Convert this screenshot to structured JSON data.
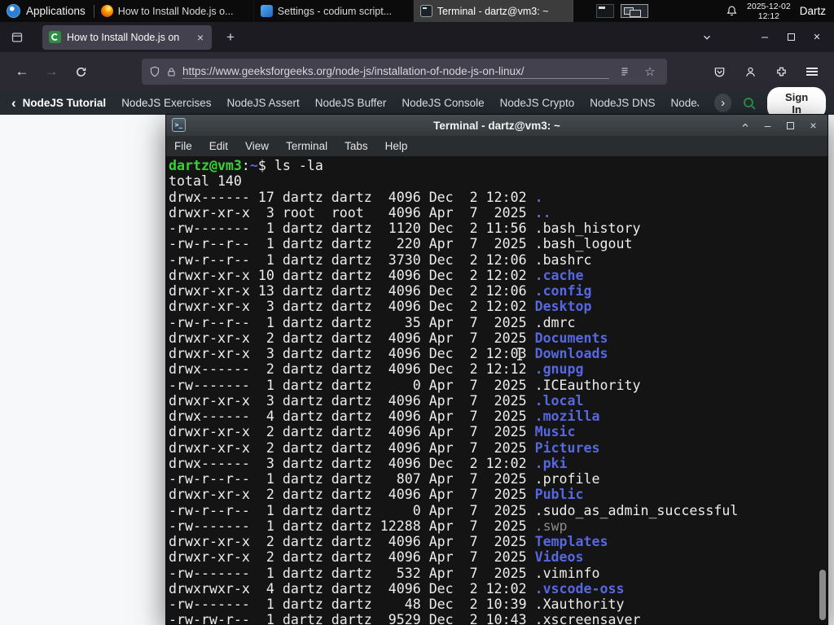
{
  "panel": {
    "applications": "Applications",
    "windows": [
      "How to Install Node.js o...",
      "Settings - codium script...",
      "Terminal - dartz@vm3: ~"
    ],
    "date": "2025-12-02",
    "time": "12:12",
    "user": "Dartz"
  },
  "browser": {
    "tab_title": "How to Install Node.js on",
    "url": "https://www.geeksforgeeks.org/node-js/installation-of-node-js-on-linux/"
  },
  "gfg": {
    "nav": [
      "NodeJS Tutorial",
      "NodeJS Exercises",
      "NodeJS Assert",
      "NodeJS Buffer",
      "NodeJS Console",
      "NodeJS Crypto",
      "NodeJS DNS",
      "NodeJS"
    ],
    "sign_in": "Sign In",
    "accent_green": "#2f8d46"
  },
  "glyphs": {
    "close": "×",
    "minimize": "–",
    "plus": "+",
    "back": "←",
    "forward": "→",
    "star": "☆",
    "chevron_left": "‹",
    "chevron_right": "›",
    "terminal_prompt": ">_"
  },
  "terminal": {
    "title": "Terminal - dartz@vm3: ~",
    "menu": [
      "File",
      "Edit",
      "View",
      "Terminal",
      "Tabs",
      "Help"
    ],
    "colors": {
      "prompt_green": "#35d435",
      "dir_blue": "#5767e0",
      "foreground": "#ededed",
      "dim": "#8a8a8a",
      "background": "#141414"
    },
    "lines": [
      [
        {
          "t": "dartz@vm3",
          "c": "g"
        },
        {
          "t": ":",
          "c": "f"
        },
        {
          "t": "~",
          "c": "b"
        },
        {
          "t": "$ ls -la",
          "c": "f"
        }
      ],
      [
        {
          "t": "total 140",
          "c": "f"
        }
      ],
      [
        {
          "t": "drwx------ 17 dartz dartz  4096 Dec  2 12:02 ",
          "c": "f"
        },
        {
          "t": ".",
          "c": "b"
        }
      ],
      [
        {
          "t": "drwxr-xr-x  3 root  root   4096 Apr  7  2025 ",
          "c": "f"
        },
        {
          "t": "..",
          "c": "b"
        }
      ],
      [
        {
          "t": "-rw-------  1 dartz dartz  1120 Dec  2 11:56 ",
          "c": "f"
        },
        {
          "t": ".bash_history",
          "c": "f"
        }
      ],
      [
        {
          "t": "-rw-r--r--  1 dartz dartz   220 Apr  7  2025 ",
          "c": "f"
        },
        {
          "t": ".bash_logout",
          "c": "f"
        }
      ],
      [
        {
          "t": "-rw-r--r--  1 dartz dartz  3730 Dec  2 12:06 ",
          "c": "f"
        },
        {
          "t": ".bashrc",
          "c": "f"
        }
      ],
      [
        {
          "t": "drwxr-xr-x 10 dartz dartz  4096 Dec  2 12:02 ",
          "c": "f"
        },
        {
          "t": ".cache",
          "c": "b"
        }
      ],
      [
        {
          "t": "drwxr-xr-x 13 dartz dartz  4096 Dec  2 12:06 ",
          "c": "f"
        },
        {
          "t": ".config",
          "c": "b"
        }
      ],
      [
        {
          "t": "drwxr-xr-x  3 dartz dartz  4096 Dec  2 12:02 ",
          "c": "f"
        },
        {
          "t": "Desktop",
          "c": "b"
        }
      ],
      [
        {
          "t": "-rw-r--r--  1 dartz dartz    35 Apr  7  2025 ",
          "c": "f"
        },
        {
          "t": ".dmrc",
          "c": "f"
        }
      ],
      [
        {
          "t": "drwxr-xr-x  2 dartz dartz  4096 Apr  7  2025 ",
          "c": "f"
        },
        {
          "t": "Documents",
          "c": "b"
        }
      ],
      [
        {
          "t": "drwxr-xr-x  3 dartz dartz  4096 Dec  2 12:03 ",
          "c": "f"
        },
        {
          "t": "Downloads",
          "c": "b"
        }
      ],
      [
        {
          "t": "drwx------  2 dartz dartz  4096 Dec  2 12:12 ",
          "c": "f"
        },
        {
          "t": ".gnupg",
          "c": "b"
        }
      ],
      [
        {
          "t": "-rw-------  1 dartz dartz     0 Apr  7  2025 ",
          "c": "f"
        },
        {
          "t": ".ICEauthority",
          "c": "f"
        }
      ],
      [
        {
          "t": "drwxr-xr-x  3 dartz dartz  4096 Apr  7  2025 ",
          "c": "f"
        },
        {
          "t": ".local",
          "c": "b"
        }
      ],
      [
        {
          "t": "drwx------  4 dartz dartz  4096 Apr  7  2025 ",
          "c": "f"
        },
        {
          "t": ".mozilla",
          "c": "b"
        }
      ],
      [
        {
          "t": "drwxr-xr-x  2 dartz dartz  4096 Apr  7  2025 ",
          "c": "f"
        },
        {
          "t": "Music",
          "c": "b"
        }
      ],
      [
        {
          "t": "drwxr-xr-x  2 dartz dartz  4096 Apr  7  2025 ",
          "c": "f"
        },
        {
          "t": "Pictures",
          "c": "b"
        }
      ],
      [
        {
          "t": "drwx------  3 dartz dartz  4096 Dec  2 12:02 ",
          "c": "f"
        },
        {
          "t": ".pki",
          "c": "b"
        }
      ],
      [
        {
          "t": "-rw-r--r--  1 dartz dartz   807 Apr  7  2025 ",
          "c": "f"
        },
        {
          "t": ".profile",
          "c": "f"
        }
      ],
      [
        {
          "t": "drwxr-xr-x  2 dartz dartz  4096 Apr  7  2025 ",
          "c": "f"
        },
        {
          "t": "Public",
          "c": "b"
        }
      ],
      [
        {
          "t": "-rw-r--r--  1 dartz dartz     0 Apr  7  2025 ",
          "c": "f"
        },
        {
          "t": ".sudo_as_admin_successful",
          "c": "f"
        }
      ],
      [
        {
          "t": "-rw-------  1 dartz dartz 12288 Apr  7  2025 ",
          "c": "f"
        },
        {
          "t": ".swp",
          "c": "d"
        }
      ],
      [
        {
          "t": "drwxr-xr-x  2 dartz dartz  4096 Apr  7  2025 ",
          "c": "f"
        },
        {
          "t": "Templates",
          "c": "b"
        }
      ],
      [
        {
          "t": "drwxr-xr-x  2 dartz dartz  4096 Apr  7  2025 ",
          "c": "f"
        },
        {
          "t": "Videos",
          "c": "b"
        }
      ],
      [
        {
          "t": "-rw-------  1 dartz dartz   532 Apr  7  2025 ",
          "c": "f"
        },
        {
          "t": ".viminfo",
          "c": "f"
        }
      ],
      [
        {
          "t": "drwxrwxr-x  4 dartz dartz  4096 Dec  2 12:02 ",
          "c": "f"
        },
        {
          "t": ".vscode-oss",
          "c": "b"
        }
      ],
      [
        {
          "t": "-rw-------  1 dartz dartz    48 Dec  2 10:39 ",
          "c": "f"
        },
        {
          "t": ".Xauthority",
          "c": "f"
        }
      ],
      [
        {
          "t": "-rw-rw-r--  1 dartz dartz  9529 Dec  2 10:43 ",
          "c": "f"
        },
        {
          "t": ".xscreensaver",
          "c": "f"
        }
      ]
    ]
  }
}
